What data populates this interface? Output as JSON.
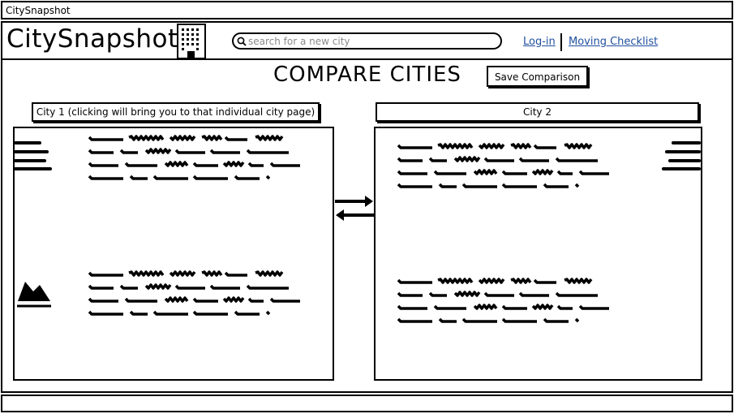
{
  "window": {
    "title": "CitySnapshot"
  },
  "header": {
    "app_title": "CitySnapshot",
    "search": {
      "placeholder": "search for a new city",
      "value": ""
    },
    "links": {
      "login": "Log-in",
      "checklist": "Moving Checklist"
    }
  },
  "page": {
    "heading": "COMPARE CITIES",
    "save_button": "Save Comparison"
  },
  "cities": [
    {
      "tab_label": "City 1 (clicking will bring you to that individual city page)"
    },
    {
      "tab_label": "City 2"
    }
  ],
  "icons": {
    "building": "building-icon",
    "search": "search-icon",
    "menu": "hamburger-menu-icon",
    "swap": "swap-arrows-icon",
    "image": "image-placeholder-icon"
  }
}
